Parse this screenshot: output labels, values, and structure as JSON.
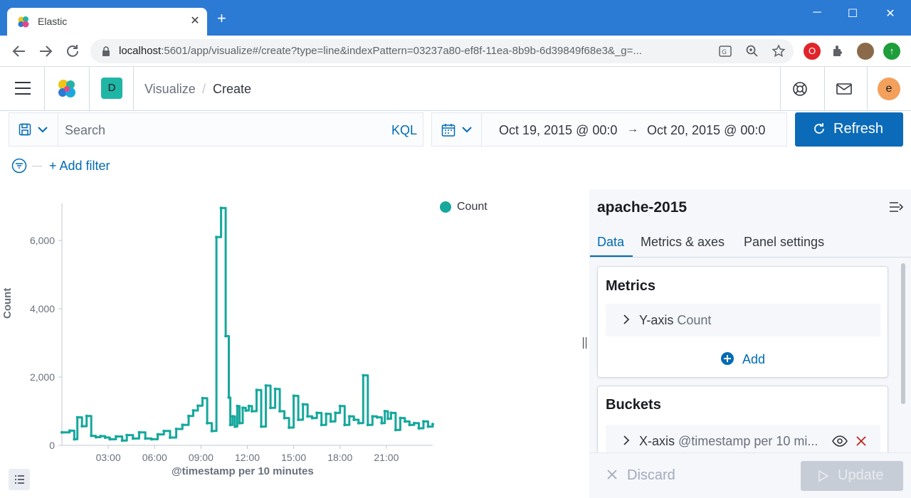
{
  "browser": {
    "tab_title": "Elastic",
    "tab_close": "✕",
    "new_tab": "+",
    "url_host": "localhost",
    "url_rest": ":5601/app/visualize#/create?type=line&indexPattern=03237a80-ef8f-11ea-8b9b-6d39849f68e3&_g=...",
    "window_controls": [
      "─",
      "☐",
      "✕"
    ]
  },
  "header": {
    "space_initial": "D",
    "breadcrumbs": [
      "Visualize",
      "Create"
    ],
    "user_initial": "e"
  },
  "query": {
    "search_placeholder": "Search",
    "language": "KQL",
    "date_start": "Oct 19, 2015 @ 00:0",
    "date_end": "Oct 20, 2015 @ 00:0",
    "date_arrow": "→",
    "refresh_label": "Refresh",
    "add_filter": "+ Add filter"
  },
  "sidebar": {
    "index_title": "apache-2015",
    "tabs": [
      "Data",
      "Metrics & axes",
      "Panel settings"
    ],
    "metrics_title": "Metrics",
    "metric_item_label": "Y-axis",
    "metric_item_sub": "Count",
    "add_label": "Add",
    "buckets_title": "Buckets",
    "bucket_item_label": "X-axis",
    "bucket_item_sub": "@timestamp per 10 mi...",
    "discard_label": "Discard",
    "update_label": "Update"
  },
  "colors": {
    "accent": "#006bb4",
    "series": "#16a89c",
    "browser_bar": "#2b7ad4"
  },
  "chart_data": {
    "type": "line",
    "ylabel": "Count",
    "xlabel": "@timestamp per 10 minutes",
    "legend": "Count",
    "legend_position": "top-right",
    "ylim": [
      0,
      7000
    ],
    "yticks": [
      "0",
      "2,000",
      "4,000",
      "6,000"
    ],
    "ytick_values": [
      0,
      2000,
      4000,
      6000
    ],
    "xticks": [
      "03:00",
      "06:00",
      "09:00",
      "12:00",
      "15:00",
      "18:00",
      "21:00"
    ],
    "xtick_hours": [
      3,
      6,
      9,
      12,
      15,
      18,
      21
    ],
    "xlim_hours": [
      0,
      24
    ],
    "series": [
      {
        "name": "Count",
        "x_hours": [
          0.0,
          0.5,
          0.8,
          1.0,
          1.3,
          1.6,
          1.9,
          2.2,
          2.5,
          2.8,
          3.1,
          3.5,
          3.9,
          4.2,
          4.6,
          5.0,
          5.4,
          5.8,
          6.2,
          6.6,
          7.0,
          7.4,
          7.8,
          8.2,
          8.5,
          8.8,
          9.1,
          9.4,
          9.7,
          10.0,
          10.3,
          10.6,
          10.8,
          10.9,
          11.05,
          11.2,
          11.35,
          11.5,
          11.7,
          11.9,
          12.1,
          12.3,
          12.6,
          12.9,
          13.2,
          13.5,
          13.8,
          14.1,
          14.4,
          14.7,
          15.0,
          15.3,
          15.6,
          15.9,
          16.2,
          16.5,
          16.8,
          17.1,
          17.4,
          17.7,
          18.0,
          18.3,
          18.6,
          18.9,
          19.2,
          19.5,
          19.8,
          20.1,
          20.4,
          20.7,
          20.9,
          21.1,
          21.3,
          21.6,
          21.9,
          22.2,
          22.5,
          22.8,
          23.1,
          23.4,
          23.7,
          24.0
        ],
        "values": [
          380,
          430,
          180,
          820,
          560,
          860,
          280,
          240,
          270,
          230,
          180,
          260,
          140,
          300,
          200,
          380,
          200,
          180,
          320,
          420,
          230,
          480,
          600,
          860,
          1020,
          1160,
          1380,
          650,
          420,
          6100,
          6950,
          3200,
          1400,
          600,
          850,
          550,
          1150,
          650,
          1100,
          1020,
          1150,
          1000,
          1620,
          550,
          1750,
          1100,
          1650,
          1000,
          800,
          520,
          1450,
          750,
          1200,
          850,
          800,
          950,
          600,
          920,
          700,
          950,
          1150,
          600,
          850,
          750,
          650,
          2050,
          600,
          850,
          820,
          650,
          1000,
          780,
          950,
          450,
          800,
          700,
          600,
          650,
          500,
          700,
          550,
          620
        ]
      }
    ]
  }
}
